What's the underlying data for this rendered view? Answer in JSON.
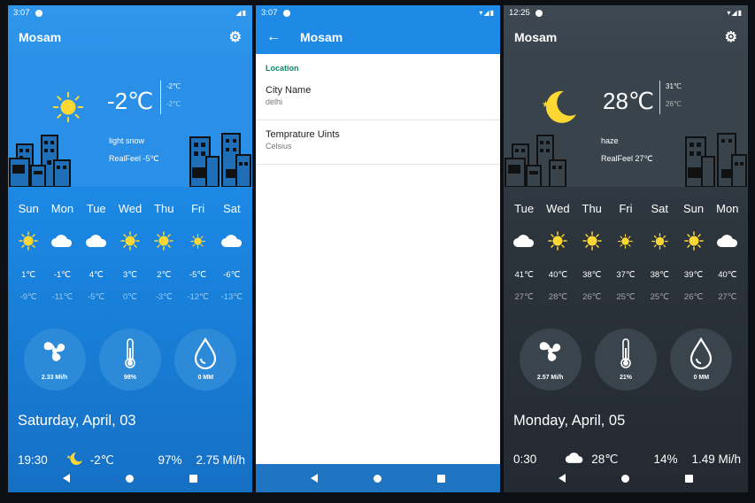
{
  "screens": [
    {
      "status_time": "3:07",
      "app_title": "Mosam",
      "current": {
        "temp": "-2℃",
        "high": "-2℃",
        "low": "-2℃",
        "condition": "light snow",
        "realfeel": "RealFeel -5℃",
        "icon": "sun-icon"
      },
      "days": [
        "Sun",
        "Mon",
        "Tue",
        "Wed",
        "Thu",
        "Fri",
        "Sat"
      ],
      "icons": [
        "sun",
        "cloud",
        "cloud",
        "sun",
        "sun",
        "sun-small",
        "cloud"
      ],
      "highs": [
        "1℃",
        "-1℃",
        "4℃",
        "3℃",
        "2℃",
        "-5℃",
        "-6℃"
      ],
      "lows": [
        "-9℃",
        "-11℃",
        "-5℃",
        "0℃",
        "-3℃",
        "-12℃",
        "-13℃"
      ],
      "gauges": {
        "wind": "2.33 Mi/h",
        "humidity": "98%",
        "rain": "0 MM"
      },
      "date": "Saturday, April, 03",
      "bottom": {
        "time": "19:30",
        "temp": "-2℃",
        "humidity": "97%",
        "wind": "2.75 Mi/h",
        "icon": "moon-icon"
      }
    },
    {
      "status_time": "3:07",
      "app_title": "Mosam",
      "section": "Location",
      "prefs": [
        {
          "title": "City Name",
          "value": "delhi"
        },
        {
          "title": "Temprature Uints",
          "value": "Celsius"
        }
      ]
    },
    {
      "status_time": "12:25",
      "app_title": "Mosam",
      "current": {
        "temp": "28℃",
        "high": "31℃",
        "low": "26℃",
        "condition": "haze",
        "realfeel": "RealFeel 27℃",
        "icon": "moon-icon"
      },
      "days": [
        "Tue",
        "Wed",
        "Thu",
        "Fri",
        "Sat",
        "Sun",
        "Mon"
      ],
      "icons": [
        "cloud",
        "sun",
        "sun",
        "sun-small",
        "sun-small",
        "sun",
        "cloud"
      ],
      "highs": [
        "41℃",
        "40℃",
        "38℃",
        "37℃",
        "38℃",
        "39℃",
        "40℃"
      ],
      "lows": [
        "27℃",
        "28℃",
        "26℃",
        "25℃",
        "25℃",
        "26℃",
        "27℃"
      ],
      "gauges": {
        "wind": "2.57 Mi/h",
        "humidity": "21%",
        "rain": "0 MM"
      },
      "date": "Monday, April, 05",
      "bottom": {
        "time": "0:30",
        "temp": "28℃",
        "humidity": "14%",
        "wind": "1.49 Mi/h",
        "icon": "cloud-icon"
      }
    }
  ],
  "colors": {
    "light_theme": "#2a8fe6",
    "dark_theme": "#39434c",
    "sun": "#fdd835",
    "settings_accent": "#0a8a6c"
  }
}
